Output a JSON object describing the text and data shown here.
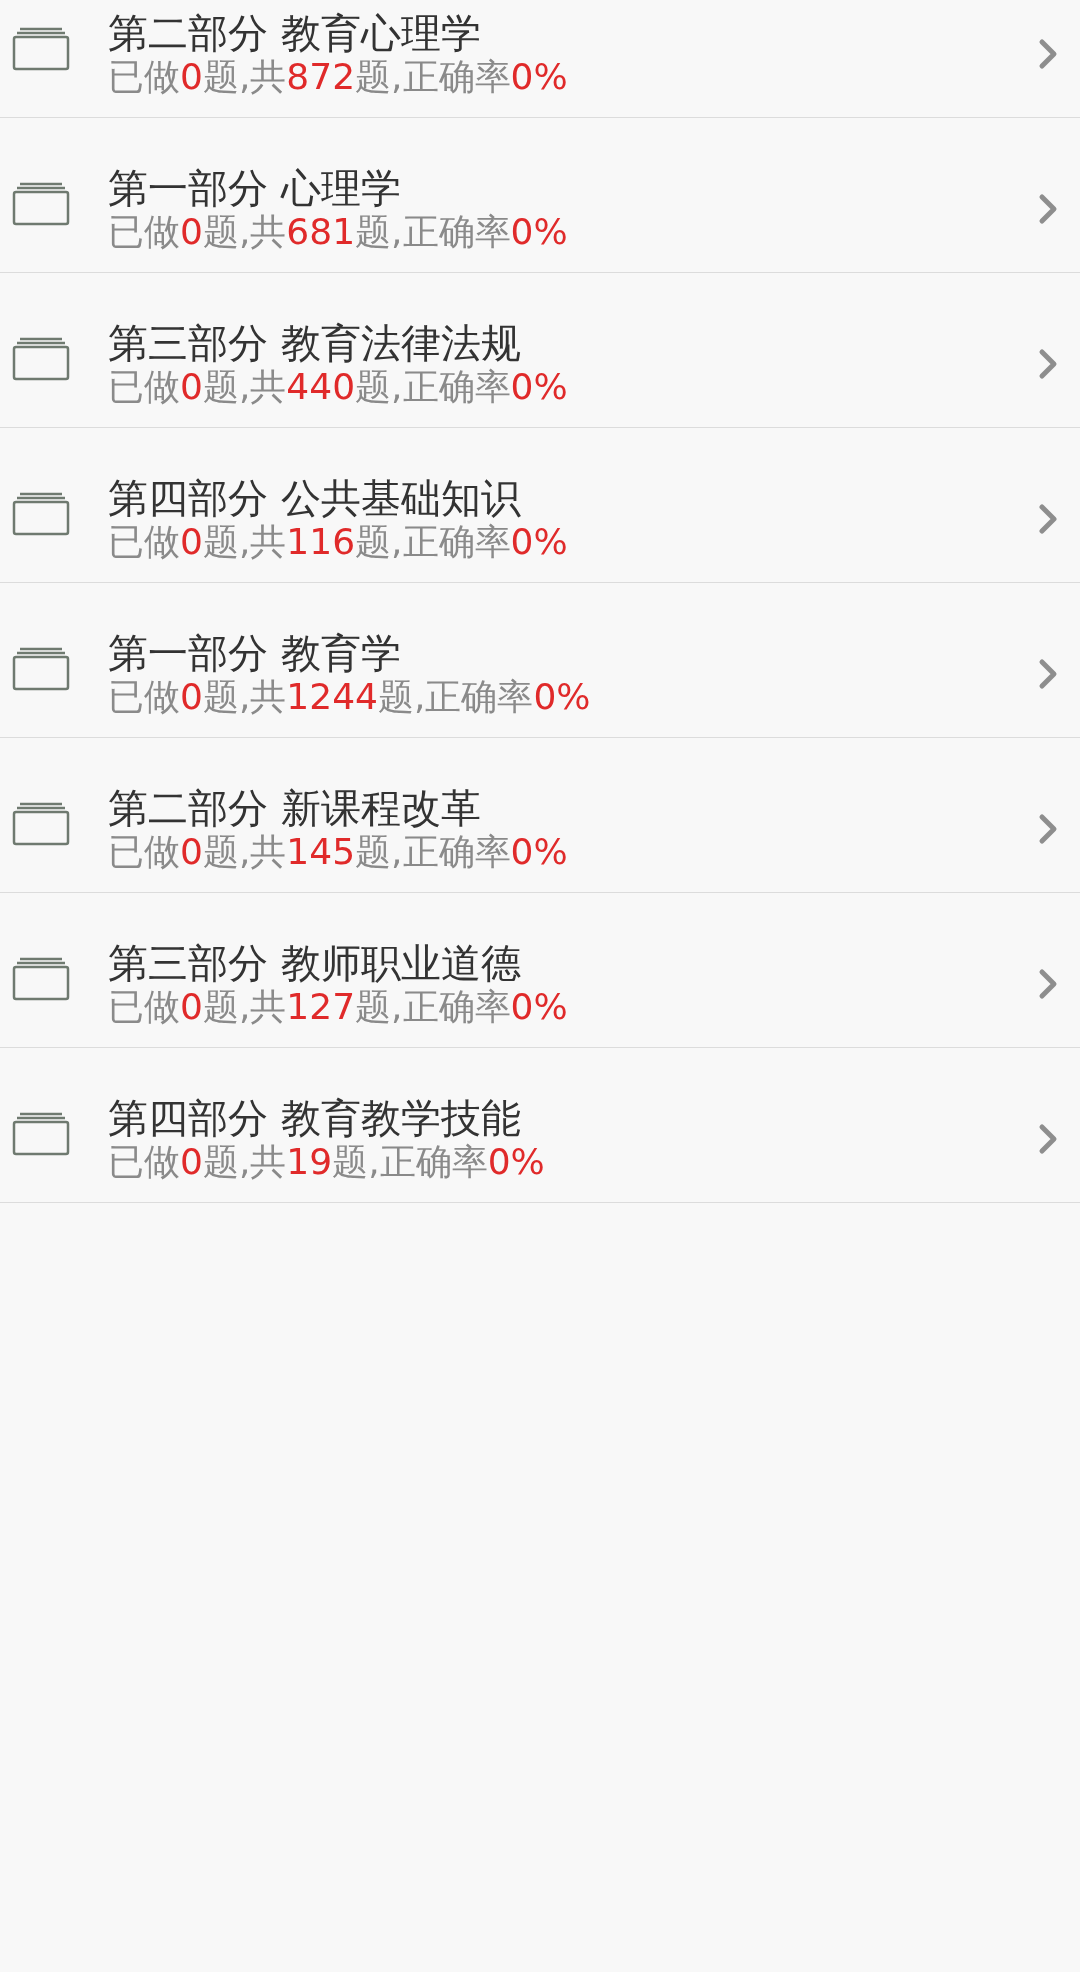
{
  "sections": [
    {
      "title": "第二部分 教育心理学",
      "stats": [
        {
          "kind": "label",
          "text": "已做"
        },
        {
          "kind": "number",
          "text": "0"
        },
        {
          "kind": "label",
          "text": "题,共"
        },
        {
          "kind": "number",
          "text": "872"
        },
        {
          "kind": "label",
          "text": "题,正确率"
        },
        {
          "kind": "number",
          "text": "0%"
        }
      ]
    },
    {
      "title": "第一部分 心理学",
      "stats": [
        {
          "kind": "label",
          "text": "已做"
        },
        {
          "kind": "number",
          "text": "0"
        },
        {
          "kind": "label",
          "text": "题,共"
        },
        {
          "kind": "number",
          "text": "681"
        },
        {
          "kind": "label",
          "text": "题,正确率"
        },
        {
          "kind": "number",
          "text": "0%"
        }
      ]
    },
    {
      "title": "第三部分 教育法律法规",
      "stats": [
        {
          "kind": "label",
          "text": "已做"
        },
        {
          "kind": "number",
          "text": "0"
        },
        {
          "kind": "label",
          "text": "题,共"
        },
        {
          "kind": "number",
          "text": "440"
        },
        {
          "kind": "label",
          "text": "题,正确率"
        },
        {
          "kind": "number",
          "text": "0%"
        }
      ]
    },
    {
      "title": "第四部分 公共基础知识",
      "stats": [
        {
          "kind": "label",
          "text": "已做"
        },
        {
          "kind": "number",
          "text": "0"
        },
        {
          "kind": "label",
          "text": "题,共"
        },
        {
          "kind": "number",
          "text": "116"
        },
        {
          "kind": "label",
          "text": "题,正确率"
        },
        {
          "kind": "number",
          "text": "0%"
        }
      ]
    },
    {
      "title": "第一部分 教育学",
      "stats": [
        {
          "kind": "label",
          "text": "已做"
        },
        {
          "kind": "number",
          "text": "0"
        },
        {
          "kind": "label",
          "text": "题,共"
        },
        {
          "kind": "number",
          "text": "1244"
        },
        {
          "kind": "label",
          "text": "题,正确率"
        },
        {
          "kind": "number",
          "text": "0%"
        }
      ]
    },
    {
      "title": "第二部分 新课程改革",
      "stats": [
        {
          "kind": "label",
          "text": "已做"
        },
        {
          "kind": "number",
          "text": "0"
        },
        {
          "kind": "label",
          "text": "题,共"
        },
        {
          "kind": "number",
          "text": "145"
        },
        {
          "kind": "label",
          "text": "题,正确率"
        },
        {
          "kind": "number",
          "text": "0%"
        }
      ]
    },
    {
      "title": "第三部分 教师职业道德",
      "stats": [
        {
          "kind": "label",
          "text": "已做"
        },
        {
          "kind": "number",
          "text": "0"
        },
        {
          "kind": "label",
          "text": "题,共"
        },
        {
          "kind": "number",
          "text": "127"
        },
        {
          "kind": "label",
          "text": "题,正确率"
        },
        {
          "kind": "number",
          "text": "0%"
        }
      ]
    },
    {
      "title": "第四部分 教育教学技能",
      "stats": [
        {
          "kind": "label",
          "text": "已做"
        },
        {
          "kind": "number",
          "text": "0"
        },
        {
          "kind": "label",
          "text": "题,共"
        },
        {
          "kind": "number",
          "text": "19"
        },
        {
          "kind": "label",
          "text": "题,正确率"
        },
        {
          "kind": "number",
          "text": "0%"
        }
      ]
    }
  ]
}
